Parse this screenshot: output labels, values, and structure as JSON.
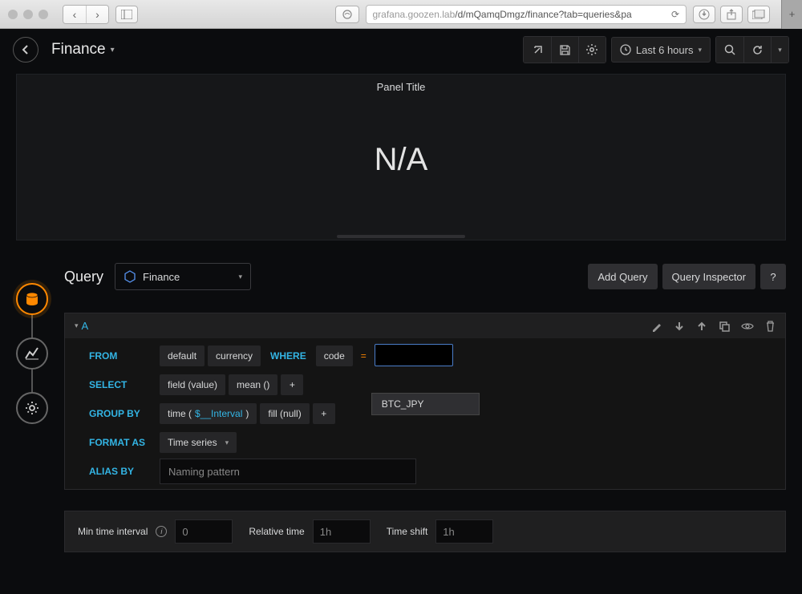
{
  "browser": {
    "url_host": "grafana.goozen.lab",
    "url_path": "/d/mQamqDmgz/finance?tab=queries&pa"
  },
  "nav": {
    "dashboard_title": "Finance",
    "time_range": "Last 6 hours"
  },
  "panel": {
    "title": "Panel Title",
    "value": "N/A"
  },
  "editor": {
    "section_label": "Query",
    "datasource": "Finance",
    "add_query": "Add Query",
    "query_inspector": "Query Inspector",
    "help": "?",
    "row_letter": "A",
    "from": {
      "kw": "FROM",
      "policy": "default",
      "measurement": "currency",
      "where_kw": "WHERE",
      "tag": "code",
      "op": "=",
      "suggestion": "BTC_JPY"
    },
    "select": {
      "kw": "SELECT",
      "field": "field (value)",
      "agg": "mean ()"
    },
    "groupby": {
      "kw": "GROUP BY",
      "time_prefix": "time (",
      "time_var": "$__Interval",
      "time_suffix": ")",
      "fill": "fill (null)"
    },
    "format": {
      "kw": "FORMAT AS",
      "value": "Time series"
    },
    "alias": {
      "kw": "ALIAS BY",
      "placeholder": "Naming pattern"
    }
  },
  "bottom": {
    "min_interval_label": "Min time interval",
    "min_interval_value": "0",
    "relative_label": "Relative time",
    "relative_value": "1h",
    "shift_label": "Time shift",
    "shift_value": "1h"
  }
}
